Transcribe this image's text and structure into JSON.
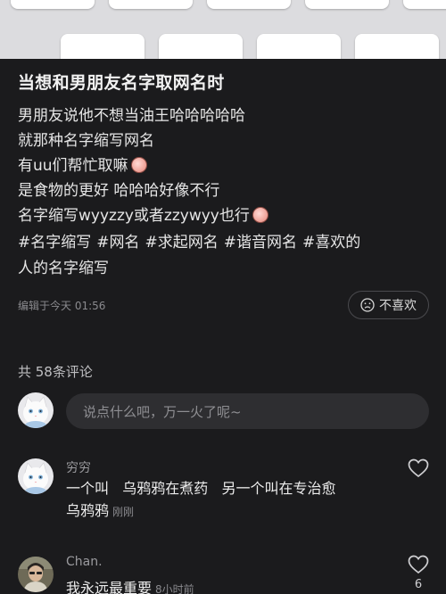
{
  "post": {
    "title": "当想和男朋友名字取网名时",
    "lines": [
      "男朋友说他不想当油王哈哈哈哈哈",
      "就那种名字缩写网名",
      "有uu们帮忙取嘛",
      "是食物的更好 哈哈哈好像不行",
      "名字缩写wyyzzy或者zzywyy也行"
    ],
    "tags": [
      "#名字缩写",
      "#网名",
      "#求起网名",
      "#谐音网名",
      "#喜欢的",
      "人的名字缩写"
    ],
    "edit_time": "编辑于今天 01:56",
    "dislike_label": "不喜欢"
  },
  "comments_section": {
    "count_label": "共 58条评论",
    "input_placeholder": "说点什么吧，万一火了呢~"
  },
  "comments": [
    {
      "user": "穷穷",
      "text_line1": "一个叫   乌鸦鸦在煮药   另一个叫在专治愈",
      "text_line2": "乌鸦鸦",
      "time": "刚刚",
      "likes": ""
    },
    {
      "user": "Chan.",
      "text_line1": "我永远最重要",
      "time": "8小时前",
      "likes": "6"
    }
  ],
  "colors": {
    "background": "#1b1b1d",
    "input_bg": "#2e2e31",
    "muted_text": "#8a8a8e"
  },
  "icons": {
    "dislike": "sad-face-icon",
    "like": "heart-outline-icon",
    "emoji": "blushing-face-emoji"
  }
}
